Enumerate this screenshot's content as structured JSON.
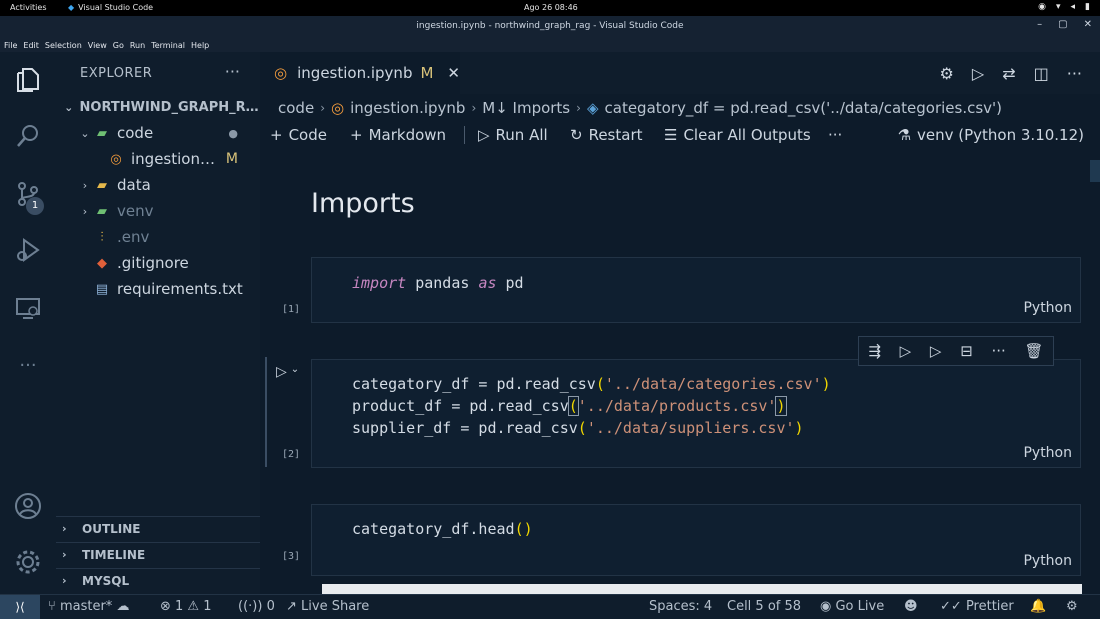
{
  "system": {
    "activities": "Activities",
    "app_name": "Visual Studio Code",
    "clock": "Ago 26  08:46"
  },
  "window": {
    "title": "ingestion.ipynb - northwind_graph_rag - Visual Studio Code"
  },
  "menu": [
    "File",
    "Edit",
    "Selection",
    "View",
    "Go",
    "Run",
    "Terminal",
    "Help"
  ],
  "activity_bar": {
    "scm_badge": "1"
  },
  "explorer": {
    "title": "EXPLORER",
    "more": "···",
    "root": "NORTHWIND_GRAPH_RAG",
    "items": [
      {
        "name": "code",
        "status": "●"
      },
      {
        "name": "ingestion.ipynb",
        "status": "M"
      },
      {
        "name": "data",
        "status": ""
      },
      {
        "name": "venv",
        "status": ""
      },
      {
        "name": ".env",
        "status": ""
      },
      {
        "name": ".gitignore",
        "status": ""
      },
      {
        "name": "requirements.txt",
        "status": ""
      }
    ],
    "sections": [
      "OUTLINE",
      "TIMELINE",
      "MYSQL"
    ]
  },
  "tab": {
    "label": "ingestion.ipynb",
    "status": "M",
    "close": "✕"
  },
  "breadcrumb": {
    "folder": "code",
    "file": "ingestion.ipynb",
    "section": "M↓ Imports",
    "symbol": "categatory_df = pd.read_csv('../data/categories.csv')"
  },
  "toolbar": {
    "code": "Code",
    "markdown": "Markdown",
    "run_all": "Run All",
    "restart": "Restart",
    "clear_outputs": "Clear All Outputs",
    "more": "···",
    "kernel": "venv (Python 3.10.12)"
  },
  "notebook": {
    "heading": "Imports",
    "language": "Python",
    "cells": [
      {
        "count": "[1]"
      },
      {
        "count": "[2]"
      },
      {
        "count": "[3]"
      }
    ]
  },
  "status": {
    "branch": "master*",
    "problems": "⊗ 1  ⚠ 1",
    "ports": "0",
    "live_share": "Live Share",
    "spaces": "Spaces: 4",
    "cell": "Cell 5 of 58",
    "go_live": "Go Live",
    "prettier": "Prettier"
  }
}
